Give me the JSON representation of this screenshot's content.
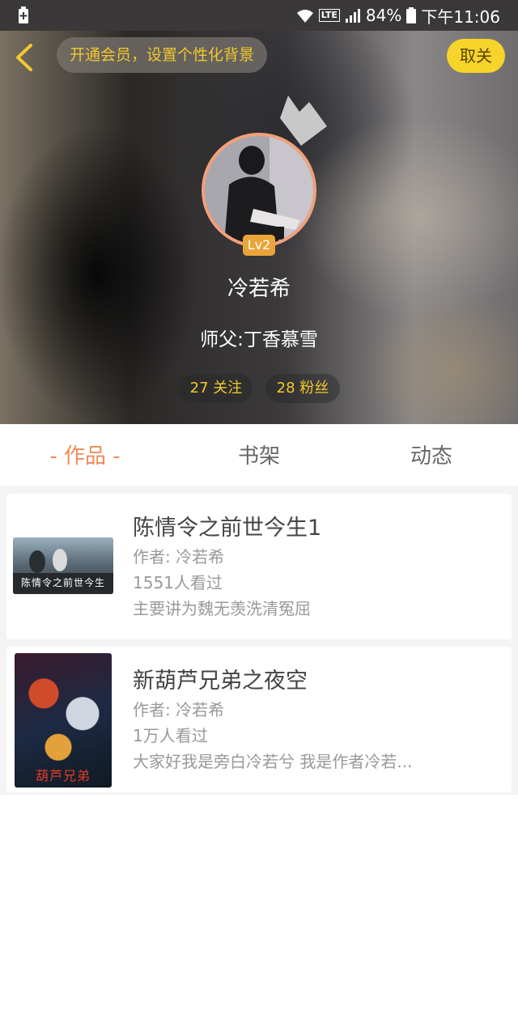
{
  "status_bar": {
    "battery_percent": "84%",
    "time": "下午11:06",
    "network_label": "LTE"
  },
  "header": {
    "vip_prompt": "开通会员，设置个性化背景",
    "unfollow_label": "取关",
    "level_badge": "Lv2",
    "nickname": "冷若希",
    "master_label": "师父:",
    "master_name": "丁香慕雪",
    "following": "27 关注",
    "fans": "28 粉丝"
  },
  "tabs": [
    {
      "label": "- 作品 -",
      "active": true
    },
    {
      "label": "书架",
      "active": false
    },
    {
      "label": "动态",
      "active": false
    }
  ],
  "works": [
    {
      "title": "陈情令之前世今生1",
      "author": "作者: 冷若希",
      "views": "1551人看过",
      "description": "主要讲为魏无羡洗清冤屈",
      "cover_text": "陈情令之前世今生"
    },
    {
      "title": "新葫芦兄弟之夜空",
      "author": "作者: 冷若希",
      "views": "1万人看过",
      "description": "大家好我是旁白冷若兮 我是作者冷若...",
      "cover_text": "葫芦兄弟"
    }
  ],
  "colors": {
    "accent_orange": "#ef8a5a",
    "accent_yellow": "#f6d42a",
    "gold_text": "#f2c92d"
  }
}
